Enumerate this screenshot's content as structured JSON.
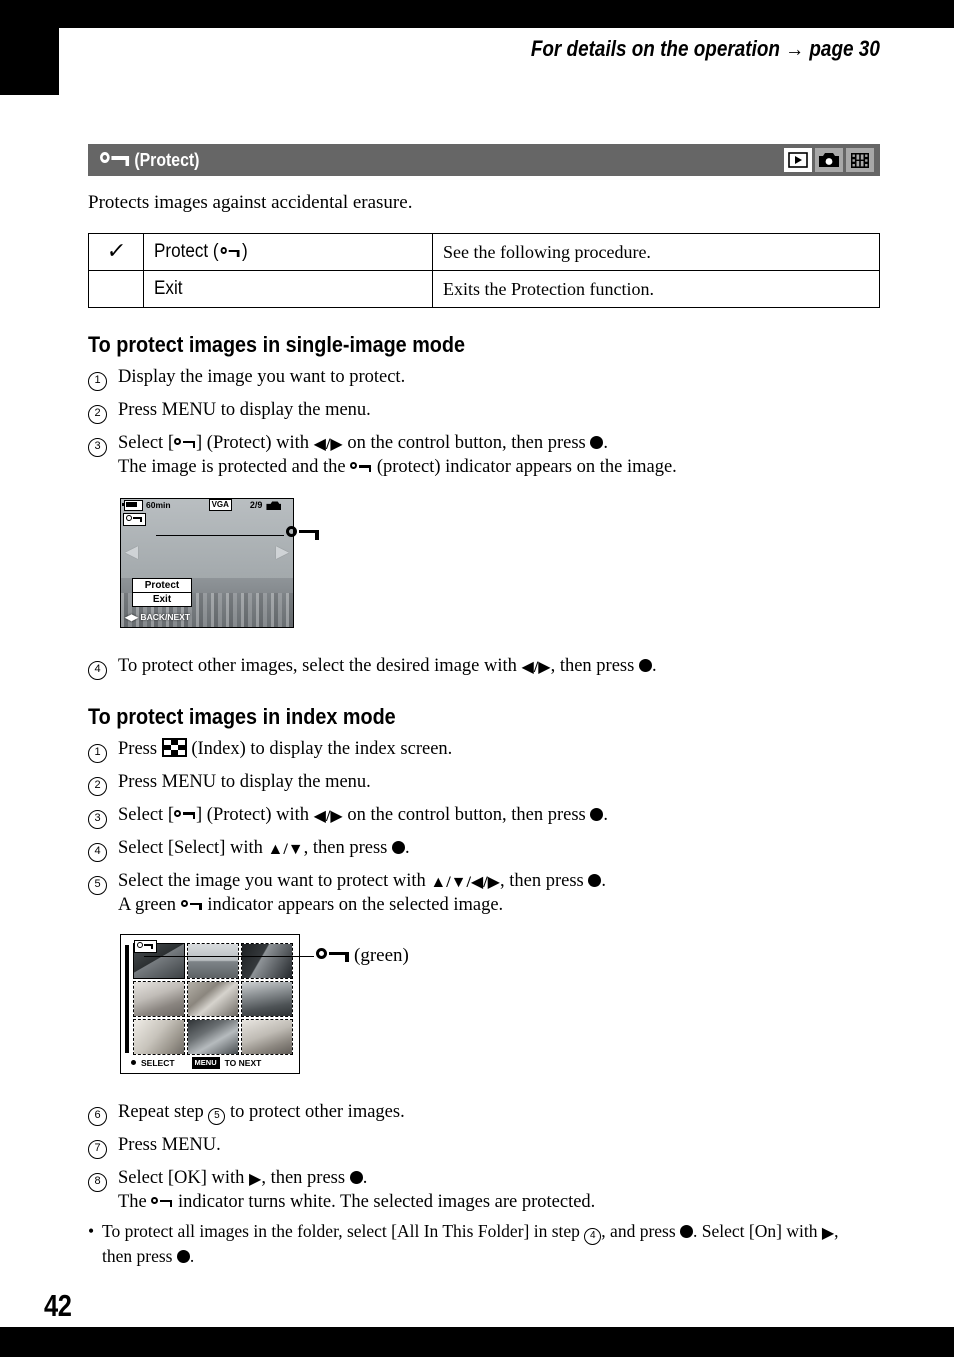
{
  "page": {
    "number": "42",
    "running_head": "For details on the operation → page 30"
  },
  "section": {
    "title": "(Protect)",
    "title_icon": "key-icon",
    "mode_icons": [
      {
        "name": "playback-icon",
        "state": "active"
      },
      {
        "name": "camera-icon",
        "state": "inactive"
      },
      {
        "name": "movie-icon",
        "state": "inactive"
      }
    ],
    "intro": "Protects images against accidental erasure."
  },
  "options_table": {
    "rows": [
      {
        "checked": true,
        "check_glyph": "✓",
        "label_prefix": "Protect (",
        "label_suffix": ")",
        "label_icon": "key-icon",
        "description": "See the following procedure."
      },
      {
        "checked": false,
        "check_glyph": "",
        "label_prefix": "Exit",
        "label_suffix": "",
        "label_icon": "",
        "description": "Exits the Protection function."
      }
    ]
  },
  "single_mode": {
    "heading": "To protect images in single-image mode",
    "steps": [
      {
        "num": "1",
        "text": "Display the image you want to protect."
      },
      {
        "num": "2",
        "text": "Press MENU to display the menu."
      },
      {
        "num": "3",
        "text_a": "Select [",
        "text_b": "] (Protect) with ",
        "text_c": " on the control button, then press ",
        "text_d": ".",
        "sub_a": "The image is protected and the ",
        "sub_b": " (protect) indicator appears on the image.",
        "arrows": "◀/▶"
      },
      {
        "num": "4",
        "text_a": "To protect other images, select the desired image with ",
        "text_b": ", then press ",
        "text_c": ".",
        "arrows": "◀/▶"
      }
    ],
    "lcd": {
      "battery_time": "60min",
      "quality": "VGA",
      "counter": "2/9",
      "badge_icon": "key-icon",
      "menu_items": [
        "Protect",
        "Exit"
      ],
      "footer": "◀▶ BACK/NEXT",
      "callout_label": "",
      "callout_icon": "key-icon"
    }
  },
  "index_mode": {
    "heading": "To protect images in index mode",
    "steps": [
      {
        "num": "1",
        "text_a": "Press ",
        "text_b": " (Index) to display the index screen."
      },
      {
        "num": "2",
        "text": "Press MENU to display the menu."
      },
      {
        "num": "3",
        "text_a": "Select [",
        "text_b": "] (Protect) with ",
        "text_c": " on the control button, then press ",
        "text_d": ".",
        "arrows": "◀/▶"
      },
      {
        "num": "4",
        "text_a": "Select [Select] with ",
        "text_b": ", then press ",
        "text_c": ".",
        "arrows": "▲/▼"
      },
      {
        "num": "5",
        "text_a": "Select the image you want to protect with ",
        "text_b": ", then press ",
        "text_c": ".",
        "arrows": "▲/▼/◀/▶",
        "sub_a": "A green ",
        "sub_b": " indicator appears on the selected image."
      },
      {
        "num": "6",
        "text_a": "Repeat step ",
        "step_ref": "5",
        "text_b": " to protect other images."
      },
      {
        "num": "7",
        "text": "Press MENU."
      },
      {
        "num": "8",
        "text_a": "Select [OK] with ",
        "text_b": ", then press ",
        "text_c": ".",
        "arrows": "▶",
        "sub_a": "The ",
        "sub_b": " indicator turns white. The selected images are protected."
      }
    ],
    "note": {
      "text_a": "To protect all images in the folder, select [All In This Folder] in step ",
      "step_ref": "4",
      "text_b": ", and press ",
      "text_c": ". Select [On] with ",
      "arrow": "▶",
      "text_d": ",",
      "text_e": "then press ",
      "text_f": "."
    },
    "lcd": {
      "badge_icon": "key-icon",
      "footer_select": "SELECT",
      "footer_menu_chip": "MENU",
      "footer_next": "TO NEXT",
      "callout_label": "(green)",
      "callout_icon": "key-icon",
      "thumbnails": [
        {
          "selected": true
        },
        {
          "selected": false
        },
        {
          "selected": false
        },
        {
          "selected": false
        },
        {
          "selected": false
        },
        {
          "selected": false
        },
        {
          "selected": false
        },
        {
          "selected": false
        },
        {
          "selected": false
        }
      ]
    }
  },
  "colors": {
    "band_gray": "#666666",
    "icon_inactive": "#a8a8a8",
    "black": "#000000"
  }
}
